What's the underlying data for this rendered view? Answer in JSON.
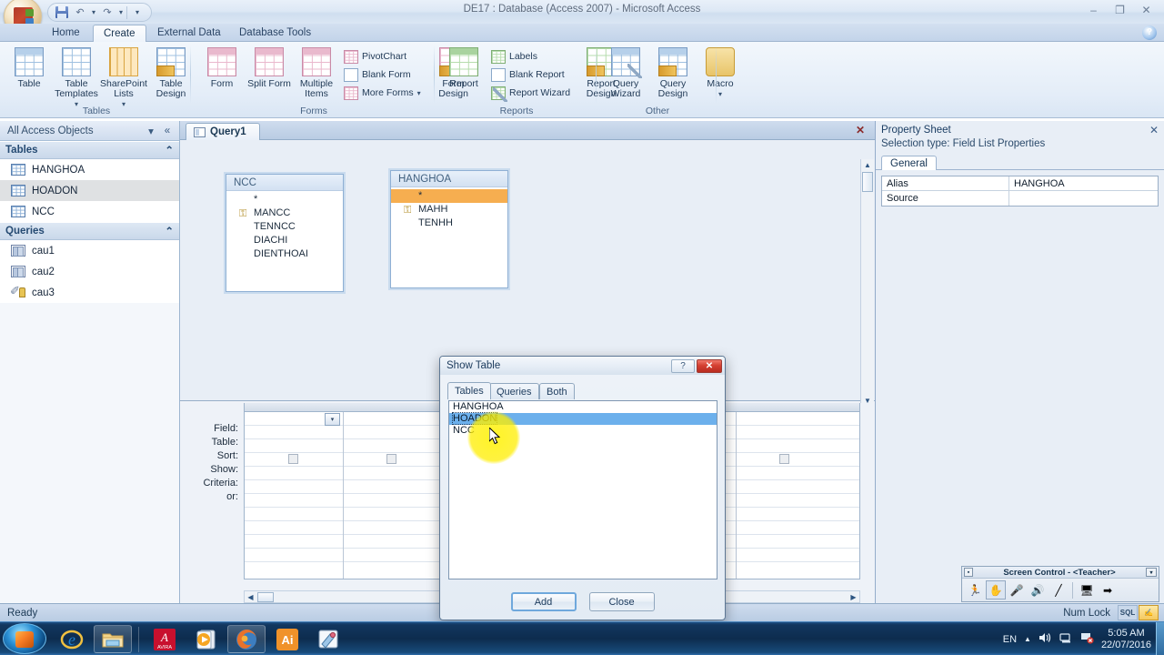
{
  "window": {
    "title": "DE17 : Database (Access 2007) - Microsoft Access",
    "minimize": "–",
    "maximize": "❐",
    "close": "✕",
    "help": "?"
  },
  "quick_access": {
    "save_icon": "save-icon",
    "undo_icon": "undo-icon",
    "redo_icon": "redo-icon",
    "customize_icon": "customize-icon",
    "undo_glyph": "↶",
    "redo_glyph": "↷",
    "caret": "▾"
  },
  "ribbon": {
    "tabs": [
      {
        "label": "Home",
        "active": false
      },
      {
        "label": "Create",
        "active": true
      },
      {
        "label": "External Data",
        "active": false
      },
      {
        "label": "Database Tools",
        "active": false
      }
    ],
    "groups": [
      {
        "name": "Tables",
        "label": "Tables",
        "buttons": [
          {
            "label": "Table",
            "icon": "table-icon"
          },
          {
            "label": "Table Templates",
            "icon": "table-templates-icon",
            "dropdown": "▾"
          },
          {
            "label": "SharePoint Lists",
            "icon": "sharepoint-lists-icon",
            "dropdown": "▾"
          },
          {
            "label": "Table Design",
            "icon": "table-design-icon"
          }
        ]
      },
      {
        "name": "Forms",
        "label": "Forms",
        "buttons": [
          {
            "label": "Form",
            "icon": "form-icon"
          },
          {
            "label": "Split Form",
            "icon": "split-form-icon"
          },
          {
            "label": "Multiple Items",
            "icon": "multiple-items-icon"
          },
          {
            "label": "Form Design",
            "icon": "form-design-icon"
          }
        ],
        "small_buttons": [
          {
            "label": "PivotChart",
            "icon": "pivotchart-icon"
          },
          {
            "label": "Blank Form",
            "icon": "blank-form-icon"
          },
          {
            "label": "More Forms",
            "icon": "more-forms-icon",
            "dropdown": "▾"
          }
        ]
      },
      {
        "name": "Reports",
        "label": "Reports",
        "buttons": [
          {
            "label": "Report",
            "icon": "report-icon"
          },
          {
            "label": "Report Design",
            "icon": "report-design-icon"
          }
        ],
        "small_buttons": [
          {
            "label": "Labels",
            "icon": "labels-icon"
          },
          {
            "label": "Blank Report",
            "icon": "blank-report-icon"
          },
          {
            "label": "Report Wizard",
            "icon": "report-wizard-icon"
          }
        ]
      },
      {
        "name": "Other",
        "label": "Other",
        "buttons": [
          {
            "label": "Query Wizard",
            "icon": "query-wizard-icon"
          },
          {
            "label": "Query Design",
            "icon": "query-design-icon"
          },
          {
            "label": "Macro",
            "icon": "macro-icon",
            "dropdown": "▾"
          }
        ]
      }
    ]
  },
  "nav_pane": {
    "header": "All Access Objects",
    "dropdown_glyph": "▾",
    "collapse_glyph": "«",
    "collapse_group_glyph": "⌃",
    "groups": [
      {
        "label": "Tables",
        "items": [
          {
            "label": "HANGHOA",
            "icon": "table-icon",
            "selected": false
          },
          {
            "label": "HOADON",
            "icon": "table-icon",
            "selected": true
          },
          {
            "label": "NCC",
            "icon": "table-icon",
            "selected": false
          }
        ]
      },
      {
        "label": "Queries",
        "items": [
          {
            "label": "cau1",
            "icon": "query-icon",
            "selected": false
          },
          {
            "label": "cau2",
            "icon": "query-icon",
            "selected": false
          },
          {
            "label": "cau3",
            "icon": "query-design-icon",
            "selected": false
          }
        ]
      }
    ]
  },
  "document": {
    "tab_label": "Query1",
    "tab_icon": "query-icon",
    "close_glyph": "✕",
    "field_lists": [
      {
        "title": "NCC",
        "rows": [
          {
            "label": "*",
            "key": false,
            "highlight": false
          },
          {
            "label": "MANCC",
            "key": true,
            "highlight": false
          },
          {
            "label": "TENNCC",
            "key": false,
            "highlight": false
          },
          {
            "label": "DIACHI",
            "key": false,
            "highlight": false
          },
          {
            "label": "DIENTHOAI",
            "key": false,
            "highlight": false
          }
        ]
      },
      {
        "title": "HANGHOA",
        "rows": [
          {
            "label": "*",
            "key": false,
            "highlight": true
          },
          {
            "label": "MAHH",
            "key": true,
            "highlight": false
          },
          {
            "label": "TENHH",
            "key": false,
            "highlight": false
          }
        ]
      }
    ]
  },
  "query_grid": {
    "row_labels": [
      "Field:",
      "Table:",
      "Sort:",
      "Show:",
      "Criteria:",
      "or:"
    ],
    "field_value": "",
    "table_value": "",
    "sort_value": "",
    "criteria_value": "",
    "or_value": "",
    "dropdown_glyph": "▾"
  },
  "property_sheet": {
    "title": "Property Sheet",
    "close_glyph": "✕",
    "selection_type": "Selection type:  Field List Properties",
    "tab": "General",
    "rows": [
      {
        "key": "Alias",
        "value": "HANGHOA"
      },
      {
        "key": "Source",
        "value": ""
      }
    ]
  },
  "show_table_dialog": {
    "title": "Show Table",
    "help_glyph": "?",
    "close_glyph": "✕",
    "tabs": [
      {
        "label": "Tables",
        "active": true
      },
      {
        "label": "Queries",
        "active": false
      },
      {
        "label": "Both",
        "active": false
      }
    ],
    "items": [
      {
        "label": "HANGHOA",
        "selected": false
      },
      {
        "label": "HOADON",
        "selected": true
      },
      {
        "label": "NCC",
        "selected": false
      }
    ],
    "add_button": "Add",
    "close_button": "Close"
  },
  "screen_control": {
    "title": "Screen Control - <Teacher>",
    "menu_glyph": "▪",
    "dropdown_glyph": "▾",
    "buttons": [
      {
        "icon": "run-student-icon",
        "glyph": "🏃",
        "active": false
      },
      {
        "icon": "hand-icon",
        "glyph": "✋",
        "active": true
      },
      {
        "icon": "microphone-icon",
        "glyph": "🎤",
        "active": false
      },
      {
        "icon": "speaker-icon",
        "glyph": "🔊",
        "active": false
      },
      {
        "icon": "pen-icon",
        "glyph": "╱",
        "active": false
      },
      {
        "icon": "monitor-icon",
        "glyph": "🖥",
        "active": false
      },
      {
        "icon": "exit-icon",
        "glyph": "➡",
        "active": false
      }
    ]
  },
  "status_bar": {
    "message": "Ready",
    "num_lock": "Num Lock",
    "views": [
      {
        "label": "SQL",
        "icon": "sql-view-icon",
        "active": false
      },
      {
        "label": "",
        "icon": "design-view-icon",
        "active": true
      }
    ]
  },
  "taskbar": {
    "start_label": "start-orb",
    "items": [
      {
        "icon": "internet-explorer-icon",
        "glyph": "e",
        "boxed": false
      },
      {
        "icon": "windows-explorer-icon",
        "glyph": "📁",
        "boxed": true
      },
      {
        "icon": "avira-icon",
        "glyph": "A",
        "boxed": false
      },
      {
        "icon": "media-player-icon",
        "glyph": "▶",
        "boxed": false
      },
      {
        "icon": "firefox-icon",
        "glyph": "🦊",
        "boxed": true
      },
      {
        "icon": "illustrator-icon",
        "glyph": "Ai",
        "boxed": false
      },
      {
        "icon": "paint-icon",
        "glyph": "✎",
        "boxed": false
      }
    ],
    "tray": {
      "language": "EN",
      "expand_glyph": "▲",
      "volume_icon": "volume-icon",
      "network_icon": "network-icon",
      "action_center_icon": "action-center-icon",
      "time": "5:05 AM",
      "date": "22/07/2016"
    }
  }
}
